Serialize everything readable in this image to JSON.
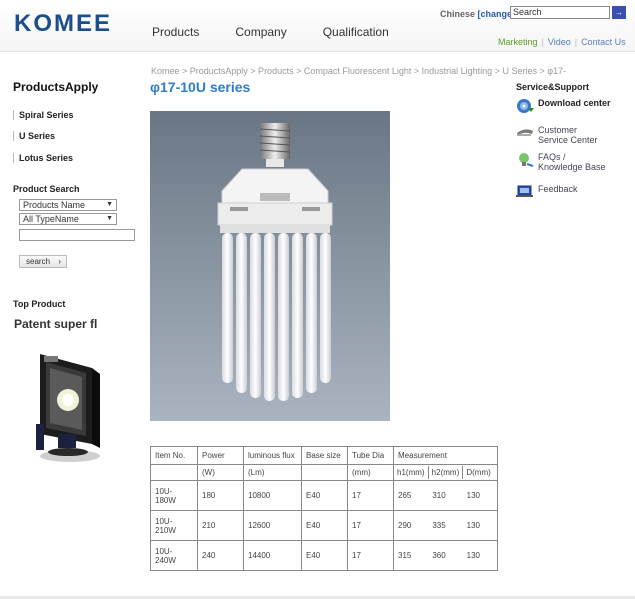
{
  "header": {
    "logo": "KOMEE",
    "nav": [
      "Products",
      "Company",
      "Qualification"
    ],
    "lang_label": "Chinese",
    "lang_change": "[change]",
    "search_value": "Search",
    "search_go": "→",
    "subnav": [
      "Marketing",
      "Video",
      "Contact Us"
    ]
  },
  "sidebar": {
    "title": "ProductsApply",
    "series": [
      "Spiral Series",
      "U Series",
      "Lotus Series"
    ],
    "product_search_title": "Product Search",
    "select_name": "Products Name",
    "select_type": "All TypeName",
    "search_button": "search",
    "search_chevron": "›",
    "top_product_title": "Top Product",
    "top_product_name": "Patent super fl"
  },
  "main": {
    "breadcrumb": "Komee > ProductsApply > Products > Compact Fluorescent Light > Industrial Lighting > U Series > φ17-",
    "title": "φ17-10U series",
    "table": {
      "headers": [
        "Item No.",
        "Power",
        "luminous flux",
        "Base size",
        "Tube Dia",
        "Measurement"
      ],
      "units": [
        "",
        "(W)",
        "(Lm)",
        "",
        "(mm)"
      ],
      "measure_sub": [
        "h1(mm)",
        "h2(mm)",
        "D(mm)"
      ],
      "rows": [
        {
          "item": "10U-180W",
          "power": "180",
          "flux": "10800",
          "base": "E40",
          "dia": "17",
          "h1": "265",
          "h2": "310",
          "d": "130"
        },
        {
          "item": "10U-210W",
          "power": "210",
          "flux": "12600",
          "base": "E40",
          "dia": "17",
          "h1": "290",
          "h2": "335",
          "d": "130"
        },
        {
          "item": "10U-240W",
          "power": "240",
          "flux": "14400",
          "base": "E40",
          "dia": "17",
          "h1": "315",
          "h2": "360",
          "d": "130"
        }
      ]
    }
  },
  "right": {
    "title": "Service&Support",
    "items": [
      {
        "label": "Download center",
        "icon": "disc-icon"
      },
      {
        "label": "Customer Service Center",
        "icon": "headset-icon"
      },
      {
        "label": "FAQs / Knowledge Base",
        "icon": "lightbulb-icon"
      },
      {
        "label": "Feedback",
        "icon": "laptop-icon"
      }
    ]
  },
  "colors": {
    "brand": "#1a4e8c",
    "title_blue": "#2f7dc7",
    "link_green": "#5aa02c",
    "link_blue": "#5c7fb8"
  }
}
